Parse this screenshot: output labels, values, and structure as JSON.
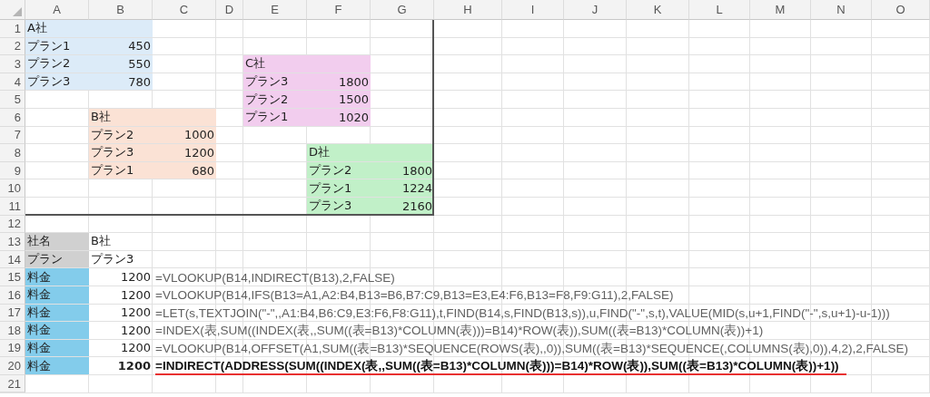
{
  "columns": [
    "A",
    "B",
    "C",
    "D",
    "E",
    "F",
    "G",
    "H",
    "I",
    "J",
    "K",
    "L",
    "M",
    "N",
    "O"
  ],
  "rows": [
    {
      "number": "1",
      "cells": [
        {
          "kind": "text",
          "text": "A社",
          "color": "#dcebf8"
        },
        {
          "kind": "fill",
          "color": "#dcebf8"
        }
      ]
    },
    {
      "number": "2",
      "cells": [
        {
          "kind": "text",
          "text": "プラン1",
          "color": "#dcebf8"
        },
        {
          "kind": "number",
          "text": "450",
          "color": "#dcebf8"
        }
      ]
    },
    {
      "number": "3",
      "cells": [
        {
          "kind": "text",
          "text": "プラン2",
          "color": "#dcebf8"
        },
        {
          "kind": "number",
          "text": "550",
          "color": "#dcebf8"
        },
        {
          "kind": "empty"
        },
        {
          "kind": "empty"
        },
        {
          "kind": "text",
          "text": "C社",
          "color": "#f2cdee"
        },
        {
          "kind": "fill",
          "color": "#f2cdee"
        }
      ]
    },
    {
      "number": "4",
      "cells": [
        {
          "kind": "text",
          "text": "プラン3",
          "color": "#dcebf8"
        },
        {
          "kind": "number",
          "text": "780",
          "color": "#dcebf8"
        },
        {
          "kind": "empty"
        },
        {
          "kind": "empty"
        },
        {
          "kind": "text",
          "text": "プラン3",
          "color": "#f2cdee"
        },
        {
          "kind": "number",
          "text": "1800",
          "color": "#f2cdee"
        }
      ]
    },
    {
      "number": "5",
      "cells": [
        {
          "kind": "empty"
        },
        {
          "kind": "empty"
        },
        {
          "kind": "empty"
        },
        {
          "kind": "empty"
        },
        {
          "kind": "text",
          "text": "プラン2",
          "color": "#f2cdee"
        },
        {
          "kind": "number",
          "text": "1500",
          "color": "#f2cdee"
        }
      ]
    },
    {
      "number": "6",
      "cells": [
        {
          "kind": "empty"
        },
        {
          "kind": "text",
          "text": "B社",
          "color": "#fbe2d5"
        },
        {
          "kind": "fill",
          "color": "#fbe2d5"
        },
        {
          "kind": "empty"
        },
        {
          "kind": "text",
          "text": "プラン1",
          "color": "#f2cdee"
        },
        {
          "kind": "number",
          "text": "1020",
          "color": "#f2cdee"
        }
      ]
    },
    {
      "number": "7",
      "cells": [
        {
          "kind": "empty"
        },
        {
          "kind": "text",
          "text": "プラン2",
          "color": "#fbe2d5"
        },
        {
          "kind": "number",
          "text": "1000",
          "color": "#fbe2d5"
        }
      ]
    },
    {
      "number": "8",
      "cells": [
        {
          "kind": "empty"
        },
        {
          "kind": "text",
          "text": "プラン3",
          "color": "#fbe2d5"
        },
        {
          "kind": "number",
          "text": "1200",
          "color": "#fbe2d5"
        },
        {
          "kind": "empty"
        },
        {
          "kind": "empty"
        },
        {
          "kind": "text",
          "text": "D社",
          "color": "#c1f0c8"
        },
        {
          "kind": "fill",
          "color": "#c1f0c8"
        }
      ]
    },
    {
      "number": "9",
      "cells": [
        {
          "kind": "empty"
        },
        {
          "kind": "text",
          "text": "プラン1",
          "color": "#fbe2d5"
        },
        {
          "kind": "number",
          "text": "680",
          "color": "#fbe2d5"
        },
        {
          "kind": "empty"
        },
        {
          "kind": "empty"
        },
        {
          "kind": "text",
          "text": "プラン2",
          "color": "#c1f0c8"
        },
        {
          "kind": "number",
          "text": "1800",
          "color": "#c1f0c8"
        }
      ]
    },
    {
      "number": "10",
      "cells": [
        {
          "kind": "empty"
        },
        {
          "kind": "empty"
        },
        {
          "kind": "empty"
        },
        {
          "kind": "empty"
        },
        {
          "kind": "empty"
        },
        {
          "kind": "text",
          "text": "プラン1",
          "color": "#c1f0c8"
        },
        {
          "kind": "number",
          "text": "1224",
          "color": "#c1f0c8"
        }
      ]
    },
    {
      "number": "11",
      "cells": [
        {
          "kind": "empty"
        },
        {
          "kind": "empty"
        },
        {
          "kind": "empty"
        },
        {
          "kind": "empty"
        },
        {
          "kind": "empty"
        },
        {
          "kind": "text",
          "text": "プラン3",
          "color": "#c1f0c8"
        },
        {
          "kind": "number",
          "text": "2160",
          "color": "#c1f0c8"
        }
      ]
    },
    {
      "number": "12"
    },
    {
      "number": "13",
      "cells": [
        {
          "kind": "text",
          "text": "社名",
          "color": "#d0d0d0"
        },
        {
          "kind": "text",
          "text": "B社"
        }
      ]
    },
    {
      "number": "14",
      "cells": [
        {
          "kind": "text",
          "text": "プラン",
          "color": "#d0d0d0"
        },
        {
          "kind": "text",
          "text": "プラン3"
        }
      ]
    },
    {
      "number": "15",
      "cells": [
        {
          "kind": "text",
          "text": "料金",
          "color": "#83cceb"
        },
        {
          "kind": "number",
          "text": "1200"
        },
        {
          "kind": "formula",
          "text": "=VLOOKUP(B14,INDIRECT(B13),2,FALSE)"
        }
      ]
    },
    {
      "number": "16",
      "cells": [
        {
          "kind": "text",
          "text": "料金",
          "color": "#83cceb"
        },
        {
          "kind": "number",
          "text": "1200"
        },
        {
          "kind": "formula",
          "text": "=VLOOKUP(B14,IFS(B13=A1,A2:B4,B13=B6,B7:C9,B13=E3,E4:F6,B13=F8,F9:G11),2,FALSE)"
        }
      ]
    },
    {
      "number": "17",
      "cells": [
        {
          "kind": "text",
          "text": "料金",
          "color": "#83cceb"
        },
        {
          "kind": "number",
          "text": "1200"
        },
        {
          "kind": "formula",
          "text": "=LET(s,TEXTJOIN(\"-\",,A1:B4,B6:C9,E3:F6,F8:G11),t,FIND(B14,s,FIND(B13,s)),u,FIND(\"-\",s,t),VALUE(MID(s,u+1,FIND(\"-\",s,u+1)-u-1)))"
        }
      ]
    },
    {
      "number": "18",
      "cells": [
        {
          "kind": "text",
          "text": "料金",
          "color": "#83cceb"
        },
        {
          "kind": "number",
          "text": "1200"
        },
        {
          "kind": "formula",
          "text": "=INDEX(表,SUM((INDEX(表,,SUM((表=B13)*COLUMN(表)))=B14)*ROW(表)),SUM((表=B13)*COLUMN(表))+1)"
        }
      ]
    },
    {
      "number": "19",
      "cells": [
        {
          "kind": "text",
          "text": "料金",
          "color": "#83cceb"
        },
        {
          "kind": "number",
          "text": "1200"
        },
        {
          "kind": "formula",
          "text": "=VLOOKUP(B14,OFFSET(A1,SUM((表=B13)*SEQUENCE(ROWS(表),,0)),SUM((表=B13)*SEQUENCE(,COLUMNS(表),0)),4,2),2,FALSE)"
        }
      ]
    },
    {
      "number": "20",
      "cells": [
        {
          "kind": "text",
          "text": "料金",
          "color": "#83cceb"
        },
        {
          "kind": "number",
          "text": "1200",
          "bold": true
        },
        {
          "kind": "formula",
          "text": "=INDIRECT(ADDRESS(SUM((INDEX(表,,SUM((表=B13)*COLUMN(表)))=B14)*ROW(表)),SUM((表=B13)*COLUMN(表))+1))",
          "bold": true,
          "underlined": true
        }
      ]
    },
    {
      "number": "21"
    }
  ]
}
